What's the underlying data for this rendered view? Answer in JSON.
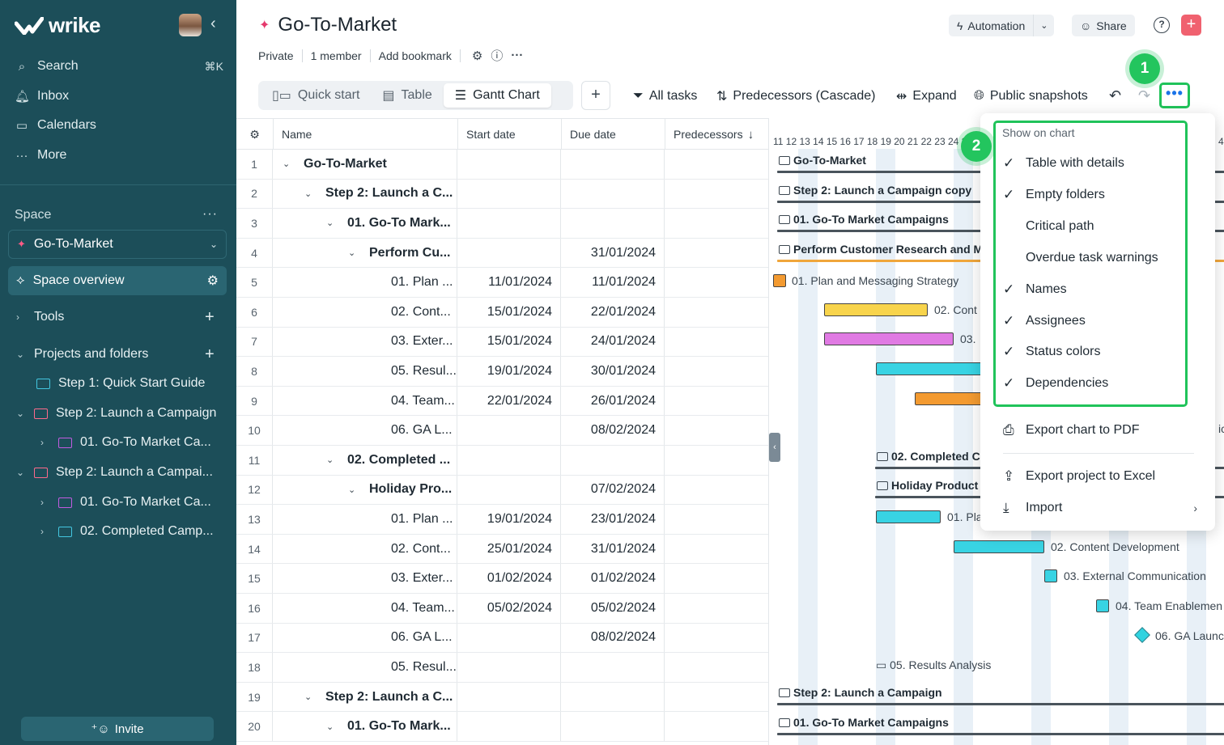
{
  "app": {
    "name": "wrike"
  },
  "sidebar": {
    "nav": [
      {
        "label": "Search",
        "icon": "search-icon",
        "shortcut": "⌘K"
      },
      {
        "label": "Inbox",
        "icon": "bell-icon"
      },
      {
        "label": "Calendars",
        "icon": "calendar-icon"
      },
      {
        "label": "More",
        "icon": "more-icon"
      }
    ],
    "space_label": "Space",
    "space_name": "Go-To-Market",
    "space_overview": "Space overview",
    "tools_label": "Tools",
    "projects_label": "Projects and folders",
    "tree": [
      {
        "label": "Step 1: Quick Start Guide"
      },
      {
        "label": "Step 2: Launch a Campaign"
      },
      {
        "label": "01. Go-To Market Ca..."
      },
      {
        "label": "Step 2: Launch a Campai..."
      },
      {
        "label": "01. Go-To Market Ca..."
      },
      {
        "label": "02. Completed Camp..."
      }
    ],
    "invite": "Invite"
  },
  "header": {
    "title": "Go-To-Market",
    "meta": {
      "privacy": "Private",
      "members": "1 member",
      "bookmark": "Add bookmark"
    },
    "automation": "Automation",
    "share": "Share",
    "help": "?"
  },
  "toolbar": {
    "tabs": [
      {
        "label": "Quick start",
        "icon": "quick-start-icon"
      },
      {
        "label": "Table",
        "icon": "table-icon"
      },
      {
        "label": "Gantt Chart",
        "icon": "gantt-icon"
      }
    ],
    "all_tasks": "All tasks",
    "predecessors": "Predecessors (Cascade)",
    "expand": "Expand",
    "public_snapshots": "Public snapshots",
    "more": "•••"
  },
  "badges": {
    "one": "1",
    "two": "2"
  },
  "table": {
    "headers": {
      "name": "Name",
      "start": "Start date",
      "due": "Due date",
      "pred": "Predecessors"
    },
    "rows": [
      {
        "num": "1",
        "name": "Go-To-Market",
        "start": "",
        "due": "",
        "toggle": "v",
        "indent": 0,
        "bold": true
      },
      {
        "num": "2",
        "name": "Step 2: Launch a C...",
        "start": "",
        "due": "",
        "toggle": "v",
        "indent": 1,
        "bold": true
      },
      {
        "num": "3",
        "name": "01. Go-To Mark...",
        "start": "",
        "due": "",
        "toggle": "v",
        "indent": 2,
        "bold": true
      },
      {
        "num": "4",
        "name": "Perform Cu...",
        "start": "",
        "due": "31/01/2024",
        "toggle": "v",
        "indent": 3,
        "bold": true
      },
      {
        "num": "5",
        "name": "01. Plan ...",
        "start": "11/01/2024",
        "due": "11/01/2024",
        "toggle": "",
        "indent": 4,
        "bold": false
      },
      {
        "num": "6",
        "name": "02. Cont...",
        "start": "15/01/2024",
        "due": "22/01/2024",
        "toggle": "",
        "indent": 4,
        "bold": false
      },
      {
        "num": "7",
        "name": "03. Exter...",
        "start": "15/01/2024",
        "due": "24/01/2024",
        "toggle": "",
        "indent": 4,
        "bold": false
      },
      {
        "num": "8",
        "name": "05. Resul...",
        "start": "19/01/2024",
        "due": "30/01/2024",
        "toggle": "",
        "indent": 4,
        "bold": false
      },
      {
        "num": "9",
        "name": "04. Team...",
        "start": "22/01/2024",
        "due": "26/01/2024",
        "toggle": "",
        "indent": 4,
        "bold": false
      },
      {
        "num": "10",
        "name": "06. GA L...",
        "start": "",
        "due": "08/02/2024",
        "toggle": "",
        "indent": 4,
        "bold": false
      },
      {
        "num": "11",
        "name": "02. Completed ...",
        "start": "",
        "due": "",
        "toggle": "v",
        "indent": 2,
        "bold": true
      },
      {
        "num": "12",
        "name": "Holiday Pro...",
        "start": "",
        "due": "07/02/2024",
        "toggle": "v",
        "indent": 3,
        "bold": true
      },
      {
        "num": "13",
        "name": "01. Plan ...",
        "start": "19/01/2024",
        "due": "23/01/2024",
        "toggle": "",
        "indent": 4,
        "bold": false
      },
      {
        "num": "14",
        "name": "02. Cont...",
        "start": "25/01/2024",
        "due": "31/01/2024",
        "toggle": "",
        "indent": 4,
        "bold": false
      },
      {
        "num": "15",
        "name": "03. Exter...",
        "start": "01/02/2024",
        "due": "01/02/2024",
        "toggle": "",
        "indent": 4,
        "bold": false
      },
      {
        "num": "16",
        "name": "04. Team...",
        "start": "05/02/2024",
        "due": "05/02/2024",
        "toggle": "",
        "indent": 4,
        "bold": false
      },
      {
        "num": "17",
        "name": "06. GA L...",
        "start": "",
        "due": "08/02/2024",
        "toggle": "",
        "indent": 4,
        "bold": false
      },
      {
        "num": "18",
        "name": "05. Resul...",
        "start": "",
        "due": "",
        "toggle": "",
        "indent": 4,
        "bold": false
      },
      {
        "num": "19",
        "name": "Step 2: Launch a C...",
        "start": "",
        "due": "",
        "toggle": "v",
        "indent": 1,
        "bold": true
      },
      {
        "num": "20",
        "name": "01. Go-To Mark...",
        "start": "",
        "due": "",
        "toggle": "v",
        "indent": 2,
        "bold": true
      }
    ]
  },
  "gantt": {
    "dates": "11 12 13 14 15 16 17 18 19 20 21 22 23 24 25",
    "edge_date": "4",
    "items": {
      "f1": "Go-To-Market",
      "f2": "Step 2: Launch a Campaign copy",
      "f3": "01. Go-To Market Campaigns",
      "f4": "Perform Customer Research and M",
      "t5": "01. Plan and Messaging Strategy",
      "t6": "02. Cont",
      "t7": "03.",
      "f11": "02. Completed C",
      "f12": "Holiday Product",
      "t13": "01. Pla",
      "t14": "02. Content Development",
      "t15": "03. External Communication",
      "t16": "04. Team Enablemen",
      "t17": "06. GA Launc",
      "t18": "05. Results Analysis",
      "f19": "Step 2: Launch a Campaign",
      "f20": "01. Go-To Market Campaigns",
      "edge": "ic"
    },
    "colors": {
      "orange": "#f39a30",
      "yellow": "#f8d44c",
      "pink": "#e07ae3",
      "cyan": "#38d3e3"
    }
  },
  "menu": {
    "header": "Show on chart",
    "options": [
      {
        "label": "Table with details",
        "checked": "✓"
      },
      {
        "label": "Empty folders",
        "checked": "✓"
      },
      {
        "label": "Critical path",
        "checked": ""
      },
      {
        "label": "Overdue task warnings",
        "checked": ""
      },
      {
        "label": "Names",
        "checked": "✓"
      },
      {
        "label": "Assignees",
        "checked": "✓"
      },
      {
        "label": "Status colors",
        "checked": "✓"
      },
      {
        "label": "Dependencies",
        "checked": "✓"
      }
    ],
    "export_pdf": "Export chart to PDF",
    "export_excel": "Export project to Excel",
    "import": "Import"
  },
  "accent": {
    "green": "#20c35a",
    "sidebar": "#1c4e59",
    "brand_pink": "#f0616f"
  }
}
